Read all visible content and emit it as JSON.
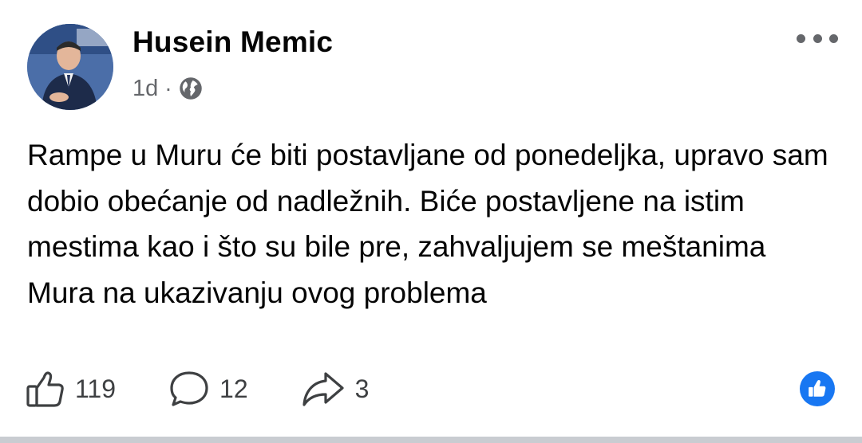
{
  "post": {
    "author": "Husein Memic",
    "time": "1d",
    "separator": "·",
    "audience_icon": "globe-icon",
    "text": "Rampe u Muru će biti postavljane od ponedeljka, upravo sam dobio obećanje od nadležnih. Biće postavljene na istim mestima kao i što su bile pre, zahvaljujem se meštanima Mura na ukazivanju ovog problema"
  },
  "actions": {
    "likes": "119",
    "comments": "12",
    "shares": "3"
  },
  "colors": {
    "accent": "#1877f2",
    "text": "#050505",
    "secondary": "#65676b"
  }
}
